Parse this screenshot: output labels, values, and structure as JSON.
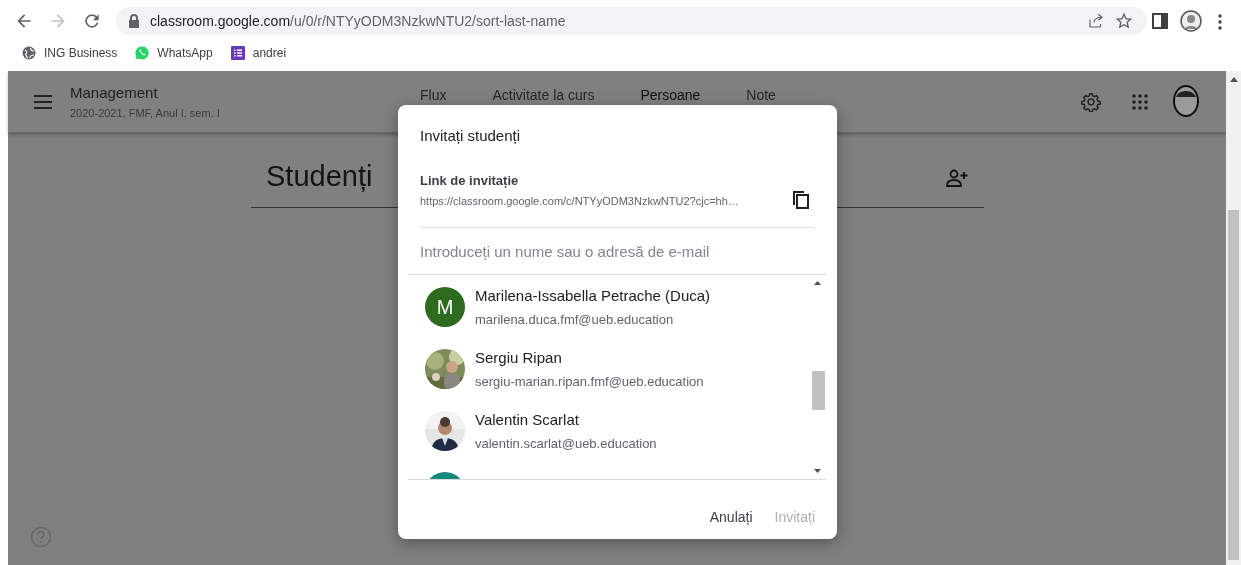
{
  "browser": {
    "url_host": "classroom.google.com",
    "url_path": "/u/0/r/NTYyODM3NzkwNTU2/sort-last-name",
    "forward_disabled": true
  },
  "bookmarks": [
    {
      "label": "ING Business",
      "kind": "globe"
    },
    {
      "label": "WhatsApp",
      "kind": "chat"
    },
    {
      "label": "andrei",
      "kind": "list"
    }
  ],
  "header": {
    "course": "Management",
    "subtitle": "2020-2021, FMF, Anul I, sem. I",
    "tabs": [
      {
        "label": "Flux",
        "selected": false
      },
      {
        "label": "Activitate la curs",
        "selected": false
      },
      {
        "label": "Persoane",
        "selected": true
      },
      {
        "label": "Note",
        "selected": false
      }
    ]
  },
  "page": {
    "heading": "Studenți"
  },
  "dialog": {
    "title": "Invitați studenți",
    "link_label": "Link de invitație",
    "link": "https://classroom.google.com/c/NTYyODM3NzkwNTU2?cjc=hh…",
    "search_placeholder": "Introduceți un nume sau o adresă de e-mail",
    "people": [
      {
        "kind": "letter",
        "letter": "M",
        "color": "#2e6b1f",
        "name": "Marilena-Issabella Petrache (Duca)",
        "email": "marilena.duca.fmf@ueb.education"
      },
      {
        "kind": "picture",
        "name": "Sergiu Ripan",
        "email": "sergiu-marian.ripan.fmf@ueb.education"
      },
      {
        "kind": "picture",
        "name": "Valentin Scarlat",
        "email": "valentin.scarlat@ueb.education"
      },
      {
        "kind": "letter",
        "color": "#12897b"
      }
    ],
    "buttons": [
      {
        "label": "Anulați",
        "disabled": false
      },
      {
        "label": "Invitați",
        "disabled": true
      }
    ]
  }
}
